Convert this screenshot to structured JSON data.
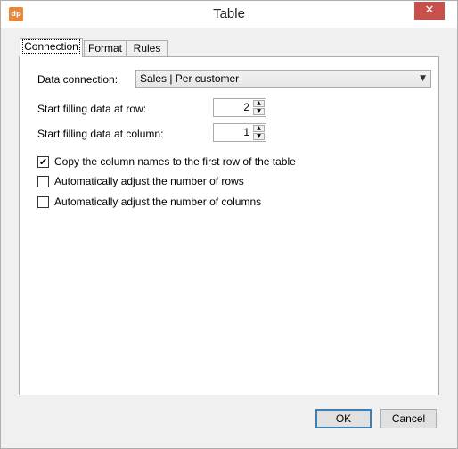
{
  "window": {
    "title": "Table",
    "app_icon_text": "dp",
    "close_glyph": "✕"
  },
  "tabs": [
    {
      "label": "Connection",
      "active": true
    },
    {
      "label": "Format",
      "active": false
    },
    {
      "label": "Rules",
      "active": false
    }
  ],
  "connection": {
    "data_connection_label": "Data connection:",
    "data_connection_value": "Sales | Per customer",
    "start_row_label": "Start filling data at row:",
    "start_row_value": "2",
    "start_column_label": "Start filling data at column:",
    "start_column_value": "1",
    "checkboxes": [
      {
        "label": "Copy the column names to the first row of the table",
        "checked": true
      },
      {
        "label": "Automatically adjust the number of rows",
        "checked": false
      },
      {
        "label": "Automatically adjust the number of columns",
        "checked": false
      }
    ]
  },
  "buttons": {
    "ok_label": "OK",
    "cancel_label": "Cancel"
  },
  "glyphs": {
    "dropdown": "▼",
    "spin_up": "▲",
    "spin_down": "▼",
    "check": "✔"
  }
}
